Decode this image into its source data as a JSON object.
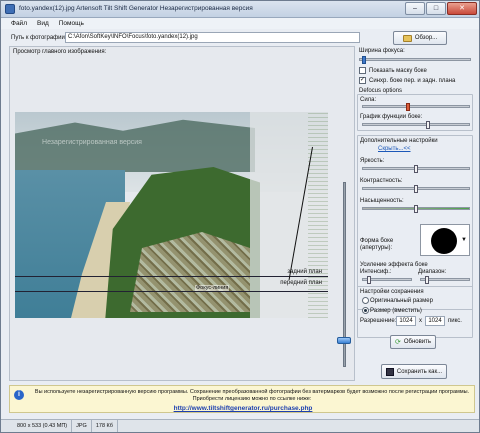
{
  "window": {
    "title": "foto.yandex(12).jpg Artensoft Tilt Shift Generator  Незарегистрированная версия",
    "buttons": {
      "minimize": "–",
      "maximize": "□",
      "close": "✕"
    }
  },
  "menu": [
    "Файл",
    "Вид",
    "Помощь"
  ],
  "path_row": {
    "label": "Путь к фотографии:",
    "value": "C:\\Afon\\SoftKey\\INFO\\Focus\\foto.yandex(12).jpg",
    "browse_label": "Обзор..."
  },
  "preview": {
    "label": "Просмотр главного изображения:",
    "watermark": "Незарегистрированная версия",
    "focus_label": "Фокус-линия",
    "back_plane_label": "задний план",
    "front_plane_label": "передний план"
  },
  "settings": {
    "focus_width_label": "Ширина фокуса:",
    "focus_width_value": 0.02,
    "show_mask_label": "Показать маску боке",
    "show_mask_checked": false,
    "sync_label": "Синхр. боке пер. и задн. плана",
    "sync_checked": true,
    "defocus_title": "Defocus options",
    "strength_label": "Сила:",
    "strength_value": 0.42,
    "bokeh_curve_label": "График функции боке:",
    "bokeh_curve_value": 0.62,
    "extra_title": "Дополнительные настройки",
    "hide_link": "Скрыть...<<",
    "brightness_label": "Яркость:",
    "brightness_value": 0.5,
    "contrast_label": "Контрастность:",
    "contrast_value": 0.5,
    "saturation_label": "Насыщенность:",
    "saturation_value": 0.5,
    "aperture_label": "Форма боке (апертуры):",
    "enhance_title": "Усиление эффекта боке",
    "intensity_label": "Интенсиф.:",
    "intensity_value": 0.1,
    "range_label": "Диапазон:",
    "range_value": 0.1,
    "save_settings_title": "Настройки сохранения",
    "original_size_label": "Оригинальный размер",
    "original_size_selected": false,
    "fit_size_label": "Размер (вместить)",
    "fit_size_selected": true,
    "resolution_label": "Разрешение:",
    "resolution_w": "1024",
    "resolution_x": "x",
    "resolution_h": "1024",
    "resolution_unit": "пикс.",
    "refresh_label": "Обновить",
    "save_label": "Сохранить как..."
  },
  "info_bar": {
    "text": "Вы используете незарегистрированную версию программы. Сохранение преобразованной фотографии без ватермарков будет возможно после регистрации программы. Приобрести лицензию можно по ссылке ниже:",
    "link": "http://www.tiltshiftgenerator.ru/purchase.php"
  },
  "statusbar": [
    "800 x 533 (0.43 МП)",
    "JPG",
    "178 Кб"
  ],
  "colors": {
    "accent": "#3e78c9",
    "slider_red": "#d95c3b",
    "info_bg": "#fbf6d2"
  }
}
